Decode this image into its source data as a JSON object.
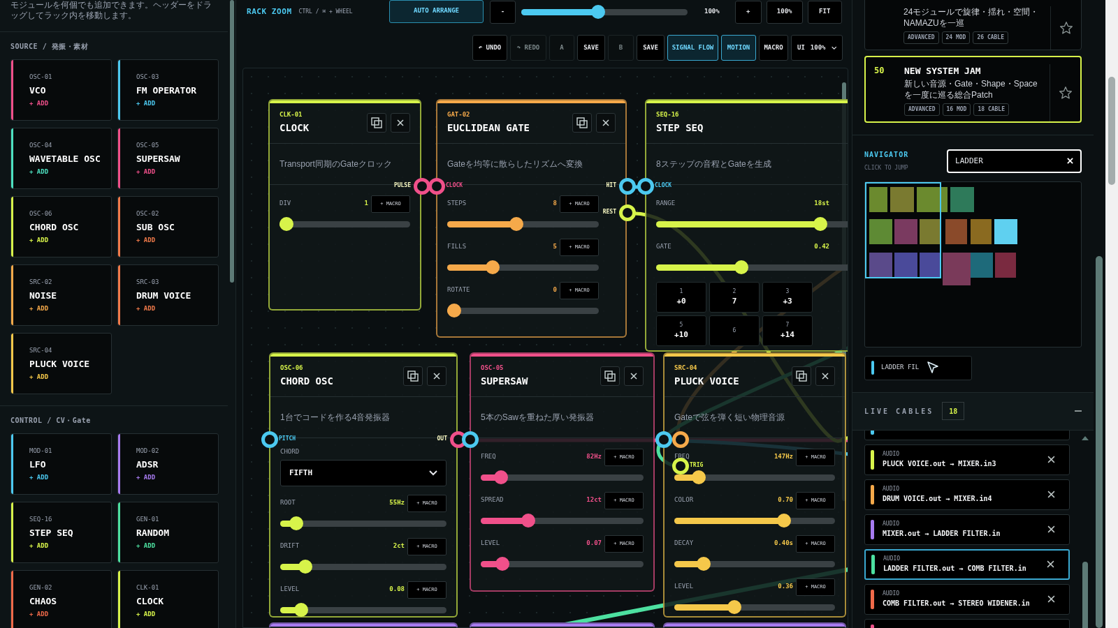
{
  "sidebar": {
    "intro": "モジュールを何個でも追加できます。ヘッダーをドラッグしてラック内を移動します。",
    "sections": [
      {
        "title": "SOURCE / 発振・素材",
        "modules": [
          {
            "code": "OSC-01",
            "name": "VCO",
            "add": "+ ADD",
            "color": "#f0508a"
          },
          {
            "code": "OSC-03",
            "name": "FM OPERATOR",
            "add": "+ ADD",
            "color": "#4cc9f0"
          },
          {
            "code": "OSC-04",
            "name": "WAVETABLE OSC",
            "add": "+ ADD",
            "color": "#4de0c0"
          },
          {
            "code": "OSC-05",
            "name": "SUPERSAW",
            "add": "+ ADD",
            "color": "#f0508a"
          },
          {
            "code": "OSC-06",
            "name": "CHORD OSC",
            "add": "+ ADD",
            "color": "#d7f34a"
          },
          {
            "code": "OSC-02",
            "name": "SUB OSC",
            "add": "+ ADD",
            "color": "#f07a4a"
          },
          {
            "code": "SRC-02",
            "name": "NOISE",
            "add": "+ ADD",
            "color": "#f5a94a"
          },
          {
            "code": "SRC-03",
            "name": "DRUM VOICE",
            "add": "+ ADD",
            "color": "#f07a4a"
          },
          {
            "code": "SRC-04",
            "name": "PLUCK VOICE",
            "add": "+ ADD",
            "color": "#f5c84a"
          }
        ]
      },
      {
        "title": "CONTROL / CV・Gate",
        "modules": [
          {
            "code": "MOD-01",
            "name": "LFO",
            "add": "+ ADD",
            "color": "#4cc9f0"
          },
          {
            "code": "MOD-02",
            "name": "ADSR",
            "add": "+ ADD",
            "color": "#a77bf0"
          },
          {
            "code": "SEQ-16",
            "name": "STEP SEQ",
            "add": "+ ADD",
            "color": "#d7f34a"
          },
          {
            "code": "GEN-01",
            "name": "RANDOM",
            "add": "+ ADD",
            "color": "#4de0a0"
          },
          {
            "code": "GEN-02",
            "name": "CHAOS",
            "add": "+ ADD",
            "color": "#f06a4a"
          },
          {
            "code": "CLK-01",
            "name": "CLOCK",
            "add": "+ ADD",
            "color": "#d7f34a"
          }
        ]
      }
    ]
  },
  "rack_toolbar": {
    "title": "RACK ZOOM",
    "hint": "CTRL / ⌘ + WHEEL",
    "auto_arrange": "AUTO ARRANGE",
    "zoom_out": "-",
    "zoom": {
      "level": 0.46
    },
    "zoom_reading": "100%",
    "zoom_in": "+",
    "zoom_reset": "100%",
    "fit": "FIT"
  },
  "history_bar": {
    "buttons": [
      {
        "label": "↶ UNDO",
        "disabled": false,
        "on": false
      },
      {
        "label": "↷ REDO",
        "disabled": true,
        "on": false
      },
      {
        "label": "A",
        "disabled": true,
        "on": false
      },
      {
        "label": "SAVE",
        "disabled": false,
        "on": false
      },
      {
        "label": "B",
        "disabled": true,
        "on": false
      },
      {
        "label": "SAVE",
        "disabled": false,
        "on": false
      },
      {
        "label": "SIGNAL FLOW",
        "disabled": false,
        "on": true
      },
      {
        "label": "MOTION",
        "disabled": false,
        "on": true
      },
      {
        "label": "MACRO",
        "disabled": false,
        "on": false
      }
    ],
    "ui_scale": {
      "label": "UI",
      "value": "100%"
    }
  },
  "rack": {
    "modules": [
      {
        "code": "CLK-01",
        "name": "CLOCK",
        "color": "#d7f34a",
        "description": "Transport同期のGateクロック",
        "ports": [
          {
            "label": "PULSE",
            "kind": "output",
            "color": "#f0508a"
          }
        ],
        "params": [
          {
            "kind": "slider",
            "label": "DIV",
            "value": "1",
            "macro": "+ MACRO",
            "level": 0
          }
        ]
      },
      {
        "code": "GAT-02",
        "name": "EUCLIDEAN GATE",
        "color": "#f5a94a",
        "description": "Gateを均等に散らしたリズムへ変換",
        "ports": [
          {
            "label": "CLOCK",
            "kind": "input",
            "color": "#f0508a"
          },
          {
            "label": "HIT",
            "kind": "output",
            "color": "#4cc9f0"
          },
          {
            "label": "REST",
            "kind": "output",
            "color": "#d7f34a"
          }
        ],
        "params": [
          {
            "kind": "slider",
            "label": "STEPS",
            "value": "8",
            "macro": "+ MACRO",
            "level": 0.45
          },
          {
            "kind": "slider",
            "label": "FILLS",
            "value": "5",
            "macro": "+ MACRO",
            "level": 0.28
          },
          {
            "kind": "slider",
            "label": "ROTATE",
            "value": "0",
            "macro": "+ MACRO",
            "level": 0
          }
        ]
      },
      {
        "code": "SEQ-16",
        "name": "STEP SEQ",
        "color": "#d7f34a",
        "description": "8ステップの音程とGateを生成",
        "ports": [
          {
            "label": "CLOCK",
            "kind": "input",
            "color": "#4cc9f0"
          }
        ],
        "params": [
          {
            "kind": "slider",
            "label": "RANGE",
            "value": "18st",
            "level": 0.78
          },
          {
            "kind": "slider",
            "label": "GATE",
            "value": "0.42",
            "level": 0.39
          }
        ],
        "steps": [
          {
            "label": "1",
            "value": "+0"
          },
          {
            "label": "2",
            "value": "7"
          },
          {
            "label": "3",
            "value": "+3"
          },
          {
            "label": "5",
            "value": "+10"
          },
          {
            "label": "6"
          },
          {
            "label": "7",
            "value": "+14"
          }
        ]
      },
      {
        "code": "OSC-06",
        "name": "CHORD OSC",
        "color": "#d7f34a",
        "description": "1台でコードを作る4音発振器",
        "ports": [
          {
            "label": "PITCH",
            "kind": "input",
            "color": "#4cc9f0"
          },
          {
            "label": "OUT",
            "kind": "output",
            "color": "#f0508a"
          }
        ],
        "params": [
          {
            "kind": "select",
            "label": "CHORD",
            "value": "FIFTH"
          },
          {
            "kind": "slider",
            "label": "ROOT",
            "value": "55Hz",
            "macro": "+ MACRO",
            "level": 0.06
          },
          {
            "kind": "slider",
            "label": "DRIFT",
            "value": "2ct",
            "macro": "+ MACRO",
            "level": 0.12
          },
          {
            "kind": "slider",
            "label": "LEVEL",
            "value": "0.08",
            "macro": "+ MACRO",
            "level": 0.09
          }
        ]
      },
      {
        "code": "OSC-05",
        "name": "SUPERSAW",
        "color": "#f0508a",
        "description": "5本のSawを重ねた厚い発振器",
        "ports": [
          {
            "kind": "input",
            "color": "#4cc9f0"
          }
        ],
        "params": [
          {
            "kind": "slider",
            "label": "FREQ",
            "value": "82Hz",
            "macro": "+ MACRO",
            "level": 0.09
          },
          {
            "kind": "slider",
            "label": "SPREAD",
            "value": "12ct",
            "macro": "+ MACRO",
            "level": 0.27
          },
          {
            "kind": "slider",
            "label": "LEVEL",
            "value": "0.07",
            "macro": "+ MACRO",
            "level": 0.1
          }
        ]
      },
      {
        "code": "SRC-04",
        "name": "PLUCK VOICE",
        "color": "#f5c84a",
        "description": "Gateで弦を弾く短い物理音源",
        "ports": [
          {
            "kind": "input",
            "color": "#4cc9f0"
          },
          {
            "kind": "input",
            "color": "#f5a94a"
          },
          {
            "label": "TRIG",
            "kind": "input",
            "color": "#d7f34a"
          }
        ],
        "params": [
          {
            "kind": "slider",
            "label": "FREQ",
            "value": "147Hz",
            "macro": "+ MACRO",
            "level": 0.12
          },
          {
            "kind": "slider",
            "label": "COLOR",
            "value": "0.70",
            "macro": "+ MACRO",
            "level": 0.7
          },
          {
            "kind": "slider",
            "label": "DECAY",
            "value": "0.40s",
            "macro": "+ MACRO",
            "level": 0.15
          },
          {
            "kind": "slider",
            "label": "LEVEL",
            "value": "0.36",
            "macro": "+ MACRO",
            "level": 0.36
          }
        ]
      }
    ],
    "next_row": [
      {
        "color": "#a77bf0"
      },
      {
        "color": "#a77bf0"
      },
      {
        "color": "#a77bf0"
      }
    ]
  },
  "presets": [
    {
      "description": "24モジュールで旋律・揺れ・空間・NAMAZUを一巡",
      "tags": [
        "ADVANCED",
        "24 MOD",
        "26 CABLE"
      ],
      "selected": false
    },
    {
      "number": "50",
      "title": "NEW SYSTEM JAM",
      "description": "新しい音源・Gate・Shape・Spaceを一度に巡る総合Patch",
      "tags": [
        "ADVANCED",
        "16 MOD",
        "18 CABLE"
      ],
      "selected": true
    }
  ],
  "navigator": {
    "title": "NAVIGATOR",
    "hint": "CLICK TO JUMP",
    "search": {
      "value": "LADDER"
    },
    "results": [
      {
        "label": "LADDER FIL"
      }
    ]
  },
  "live_cables": {
    "title": "LIVE CABLES",
    "count": "18",
    "cables": [
      {
        "color": "#4cc9f0",
        "selected": false
      },
      {
        "type": "AUDIO",
        "route": "PLUCK VOICE.out → MIXER.in3",
        "color": "#d7f34a",
        "selected": false
      },
      {
        "type": "AUDIO",
        "route": "DRUM VOICE.out → MIXER.in4",
        "color": "#f5a94a",
        "selected": false
      },
      {
        "type": "AUDIO",
        "route": "MIXER.out → LADDER FILTER.in",
        "color": "#a77bf0",
        "selected": false
      },
      {
        "type": "AUDIO",
        "route": "LADDER FILTER.out → COMB FILTER.in",
        "color": "#4de0a0",
        "selected": true
      },
      {
        "type": "AUDIO",
        "route": "COMB FILTER.out → STEREO WIDENER.in",
        "color": "#f06a4a",
        "selected": false
      },
      {
        "color": "#f0508a",
        "selected": false
      }
    ]
  }
}
